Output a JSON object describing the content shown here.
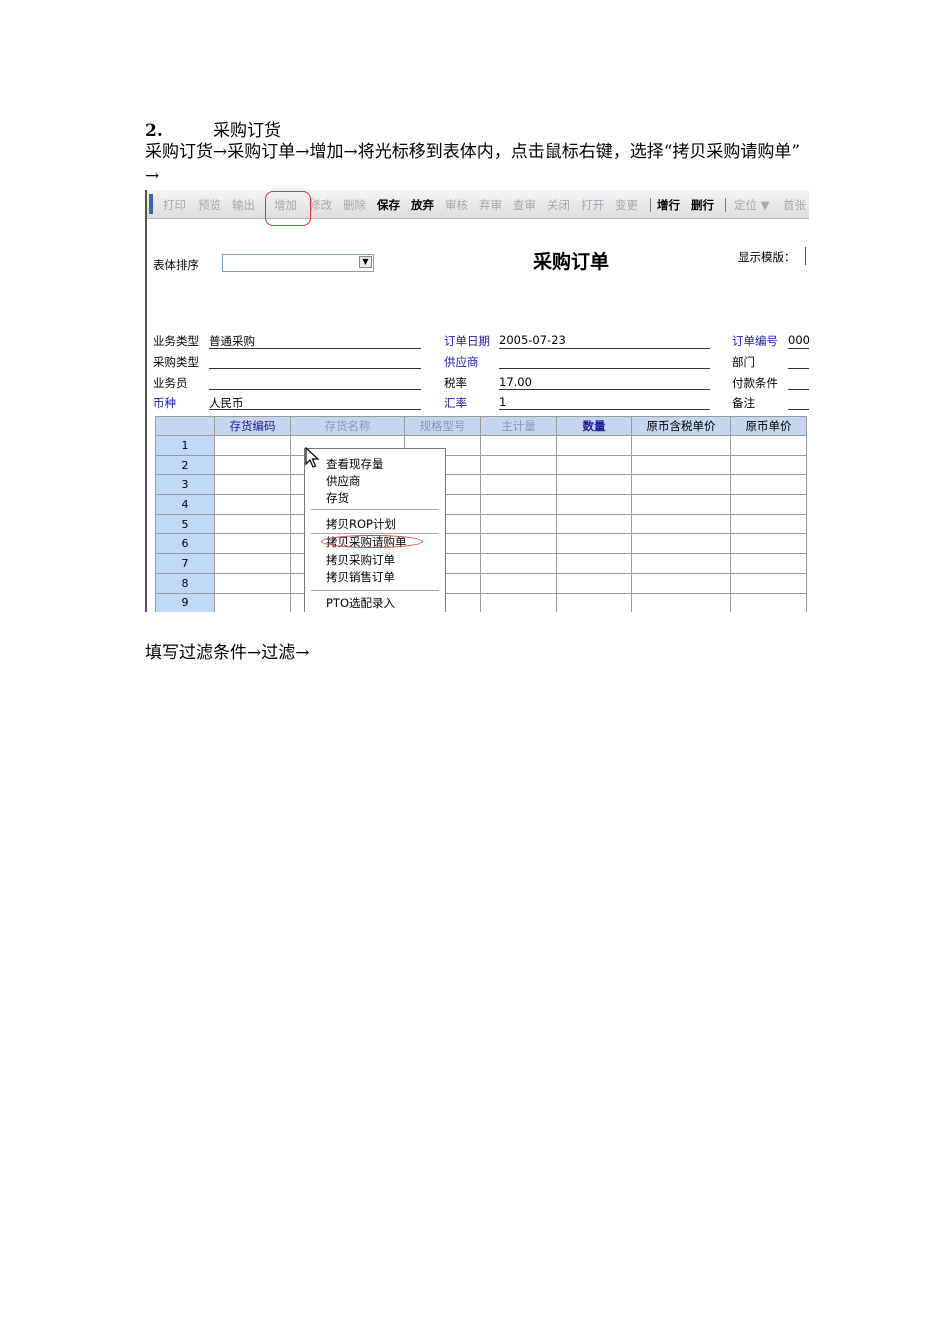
{
  "doc": {
    "heading_num": "2.",
    "heading_text": "采购订货",
    "paragraph": "采购订货→采购订单→增加→将光标移到表体内，点击鼠标右键，选择“拷贝采购请购单” →",
    "after": "填写过滤条件→过滤→"
  },
  "toolbar": {
    "buttons": [
      "打印",
      "预览",
      "输出",
      "增加",
      "修改",
      "删除",
      "保存",
      "放弃",
      "审核",
      "弃审",
      "查审",
      "关闭",
      "打开",
      "变更",
      "增行",
      "删行",
      "定位 ▼",
      "首张"
    ],
    "highlighted": "增加"
  },
  "form": {
    "title": "采购订单",
    "sort_label": "表体排序",
    "template_label": "显示模版：",
    "fields": {
      "biz_type_label": "业务类型",
      "biz_type_value": "普通采购",
      "purchase_type_label": "采购类型",
      "salesman_label": "业务员",
      "currency_label": "币种",
      "currency_value": "人民币",
      "order_date_label": "订单日期",
      "order_date_value": "2005-07-23",
      "supplier_label": "供应商",
      "tax_rate_label": "税率",
      "tax_rate_value": "17.00",
      "exchange_rate_label": "汇率",
      "exchange_rate_value": "1",
      "order_no_label": "订单编号",
      "order_no_value": "000",
      "dept_label": "部门",
      "payment_label": "付款条件",
      "remark_label": "备注"
    }
  },
  "table": {
    "columns": [
      "",
      "存货编码",
      "存货名称",
      "规格型号",
      "主计量",
      "数量",
      "原币含税单价",
      "原币单价"
    ],
    "rows": [
      "1",
      "2",
      "3",
      "4",
      "5",
      "6",
      "7",
      "8",
      "9"
    ]
  },
  "context_menu": {
    "items": [
      "查看现存量",
      "供应商",
      "存货",
      "拷贝ROP计划",
      "拷贝采购请购单",
      "拷贝采购订单",
      "拷贝销售订单",
      "PTO选配录入"
    ],
    "highlighted": "拷贝采购请购单"
  },
  "colors": {
    "header_blue": "#c6d6ef",
    "row_num_blue": "#bfd9f7",
    "label_blue": "#1a1aa8",
    "highlight_red": "#e0303a"
  }
}
